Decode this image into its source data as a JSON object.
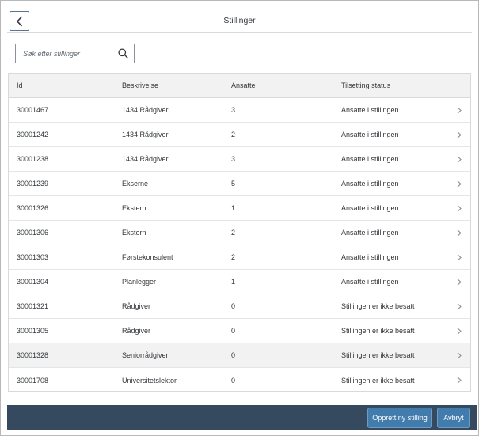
{
  "header": {
    "title": "Stillinger",
    "back_icon": "chevron-left-icon"
  },
  "search": {
    "placeholder": "Søk etter stillinger",
    "value": "",
    "icon": "search-icon"
  },
  "table": {
    "columns": [
      "Id",
      "Beskrivelse",
      "Ansatte",
      "Tilsetting status"
    ],
    "rows": [
      {
        "id": "30001467",
        "beskrivelse": "1434 Rådgiver",
        "ansatte": "3",
        "status": "Ansatte i stillingen"
      },
      {
        "id": "30001242",
        "beskrivelse": "1434 Rådgiver",
        "ansatte": "2",
        "status": "Ansatte i stillingen"
      },
      {
        "id": "30001238",
        "beskrivelse": "1434 Rådgiver",
        "ansatte": "3",
        "status": "Ansatte i stillingen"
      },
      {
        "id": "30001239",
        "beskrivelse": "Ekserne",
        "ansatte": "5",
        "status": "Ansatte i stillingen"
      },
      {
        "id": "30001326",
        "beskrivelse": "Ekstern",
        "ansatte": "1",
        "status": "Ansatte i stillingen"
      },
      {
        "id": "30001306",
        "beskrivelse": "Ekstern",
        "ansatte": "2",
        "status": "Ansatte i stillingen"
      },
      {
        "id": "30001303",
        "beskrivelse": "Førstekonsulent",
        "ansatte": "2",
        "status": "Ansatte i stillingen"
      },
      {
        "id": "30001304",
        "beskrivelse": "Planlegger",
        "ansatte": "1",
        "status": "Ansatte i stillingen"
      },
      {
        "id": "30001321",
        "beskrivelse": "Rådgiver",
        "ansatte": "0",
        "status": "Stillingen er ikke besatt"
      },
      {
        "id": "30001305",
        "beskrivelse": "Rådgiver",
        "ansatte": "0",
        "status": "Stillingen er ikke besatt"
      },
      {
        "id": "30001328",
        "beskrivelse": "Seniorrådgiver",
        "ansatte": "0",
        "status": "Stillingen er ikke besatt"
      },
      {
        "id": "30001708",
        "beskrivelse": "Universitetslektor",
        "ansatte": "0",
        "status": "Stillingen er ikke besatt"
      }
    ],
    "selected_row": 10,
    "row_icon": "chevron-right-icon"
  },
  "footer": {
    "create_label": "Opprett ny stilling",
    "cancel_label": "Avbryt"
  },
  "colors": {
    "footer_bg": "#354a5f",
    "button_bg": "#427cac",
    "header_bg": "#f2f2f2",
    "selected_row_bg": "#f2f2f2",
    "back_border": "#5b738b"
  }
}
